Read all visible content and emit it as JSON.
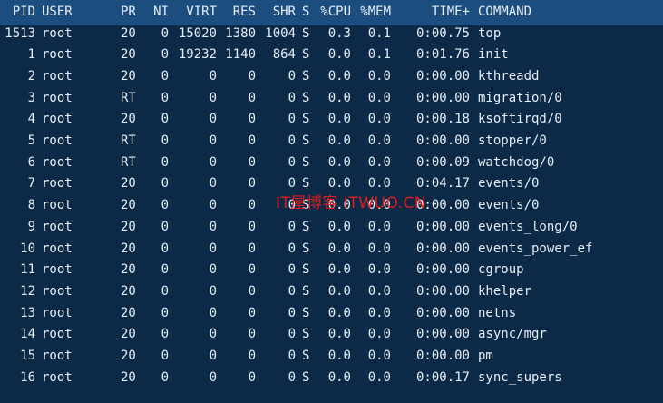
{
  "terminal": {
    "columns": [
      "PID",
      "USER",
      "PR",
      "NI",
      "VIRT",
      "RES",
      "SHR",
      "S",
      "%CPU",
      "%MEM",
      "TIME+",
      "COMMAND"
    ],
    "rows": [
      [
        "1513",
        "root",
        "20",
        "0",
        "15020",
        "1380",
        "1004",
        "S",
        "0.3",
        "0.1",
        "0:00.75",
        "top"
      ],
      [
        "1",
        "root",
        "20",
        "0",
        "19232",
        "1140",
        "864",
        "S",
        "0.0",
        "0.1",
        "0:01.76",
        "init"
      ],
      [
        "2",
        "root",
        "20",
        "0",
        "0",
        "0",
        "0",
        "S",
        "0.0",
        "0.0",
        "0:00.00",
        "kthreadd"
      ],
      [
        "3",
        "root",
        "RT",
        "0",
        "0",
        "0",
        "0",
        "S",
        "0.0",
        "0.0",
        "0:00.00",
        "migration/0"
      ],
      [
        "4",
        "root",
        "20",
        "0",
        "0",
        "0",
        "0",
        "S",
        "0.0",
        "0.0",
        "0:00.18",
        "ksoftirqd/0"
      ],
      [
        "5",
        "root",
        "RT",
        "0",
        "0",
        "0",
        "0",
        "S",
        "0.0",
        "0.0",
        "0:00.00",
        "stopper/0"
      ],
      [
        "6",
        "root",
        "RT",
        "0",
        "0",
        "0",
        "0",
        "S",
        "0.0",
        "0.0",
        "0:00.09",
        "watchdog/0"
      ],
      [
        "7",
        "root",
        "20",
        "0",
        "0",
        "0",
        "0",
        "S",
        "0.0",
        "0.0",
        "0:04.17",
        "events/0"
      ],
      [
        "8",
        "root",
        "20",
        "0",
        "0",
        "0",
        "0",
        "S",
        "0.0",
        "0.0",
        "0:00.00",
        "events/0"
      ],
      [
        "9",
        "root",
        "20",
        "0",
        "0",
        "0",
        "0",
        "S",
        "0.0",
        "0.0",
        "0:00.00",
        "events_long/0"
      ],
      [
        "10",
        "root",
        "20",
        "0",
        "0",
        "0",
        "0",
        "S",
        "0.0",
        "0.0",
        "0:00.00",
        "events_power_ef"
      ],
      [
        "11",
        "root",
        "20",
        "0",
        "0",
        "0",
        "0",
        "S",
        "0.0",
        "0.0",
        "0:00.00",
        "cgroup"
      ],
      [
        "12",
        "root",
        "20",
        "0",
        "0",
        "0",
        "0",
        "S",
        "0.0",
        "0.0",
        "0:00.00",
        "khelper"
      ],
      [
        "13",
        "root",
        "20",
        "0",
        "0",
        "0",
        "0",
        "S",
        "0.0",
        "0.0",
        "0:00.00",
        "netns"
      ],
      [
        "14",
        "root",
        "20",
        "0",
        "0",
        "0",
        "0",
        "S",
        "0.0",
        "0.0",
        "0:00.00",
        "async/mgr"
      ],
      [
        "15",
        "root",
        "20",
        "0",
        "0",
        "0",
        "0",
        "S",
        "0.0",
        "0.0",
        "0:00.00",
        "pm"
      ],
      [
        "16",
        "root",
        "20",
        "0",
        "0",
        "0",
        "0",
        "S",
        "0.0",
        "0.0",
        "0:00.17",
        "sync_supers"
      ]
    ],
    "watermark": "IT屋博客 ITWUO.CN"
  },
  "colors": {
    "background": "#0c2a47",
    "header_background": "#1b4d7f",
    "text": "#e6eef6",
    "watermark": "#e81d1d"
  }
}
